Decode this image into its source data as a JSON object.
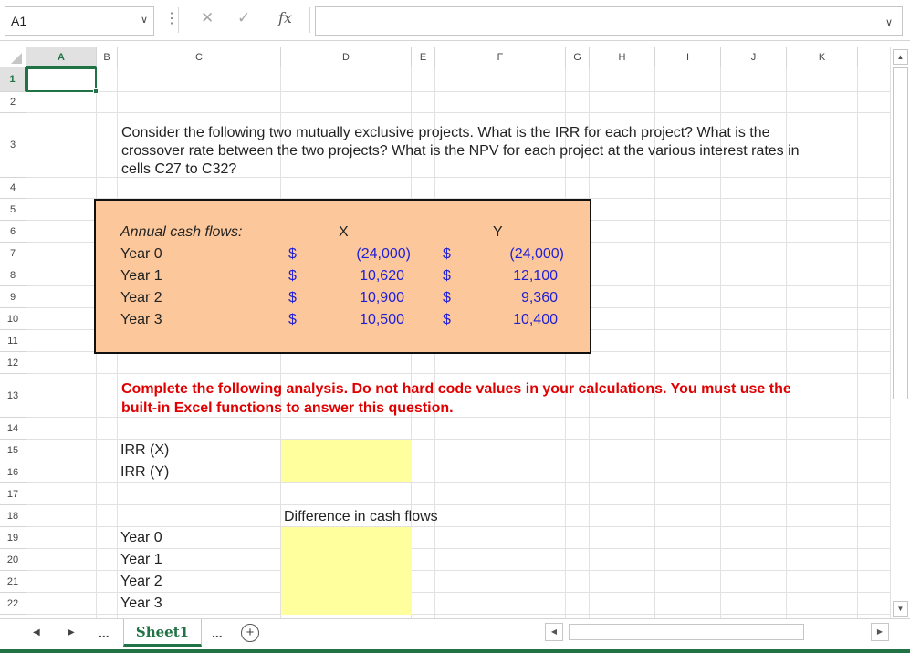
{
  "formula_bar": {
    "name_box": "A1",
    "formula": "",
    "fx_label": "fx",
    "cancel_glyph": "✕",
    "enter_glyph": "✓"
  },
  "columns": [
    "A",
    "B",
    "C",
    "D",
    "E",
    "F",
    "G",
    "H",
    "I",
    "J",
    "K"
  ],
  "rows": [
    "1",
    "2",
    "3",
    "4",
    "5",
    "6",
    "7",
    "8",
    "9",
    "10",
    "11",
    "12",
    "13",
    "14",
    "15",
    "16",
    "17",
    "18",
    "19",
    "20",
    "21",
    "22"
  ],
  "active_cell": "A1",
  "sheet": {
    "question": "Consider the following two mutually exclusive projects. What is the IRR for each project? What is the crossover rate between the two projects? What is the NPV for each project at the various interest rates in cells C27 to C32?",
    "cash_flows": {
      "heading": "Annual cash flows:",
      "col_x": "X",
      "col_y": "Y",
      "currency": "$",
      "rows": [
        {
          "label": "Year 0",
          "x": "(24,000)",
          "y": "(24,000)"
        },
        {
          "label": "Year 1",
          "x": "10,620",
          "y": "12,100"
        },
        {
          "label": "Year 2",
          "x": "10,900",
          "y": "9,360"
        },
        {
          "label": "Year 3",
          "x": "10,500",
          "y": "10,400"
        }
      ]
    },
    "instruction": "Complete the following analysis. Do not hard code values in your calculations. You must use the built-in Excel functions to answer this question.",
    "irr_x": "IRR (X)",
    "irr_y": "IRR (Y)",
    "difference_label": "Difference in cash flows",
    "diff_years": [
      "Year 0",
      "Year 1",
      "Year 2",
      "Year 3"
    ]
  },
  "tabs": {
    "sheet_name": "Sheet1",
    "add": "+",
    "more": "..."
  },
  "colors": {
    "accent": "#217346",
    "box_fill": "#fcc89b",
    "input_fill": "#ffff9e",
    "value_blue": "#1f1fd6",
    "instruction_red": "#e00000"
  }
}
